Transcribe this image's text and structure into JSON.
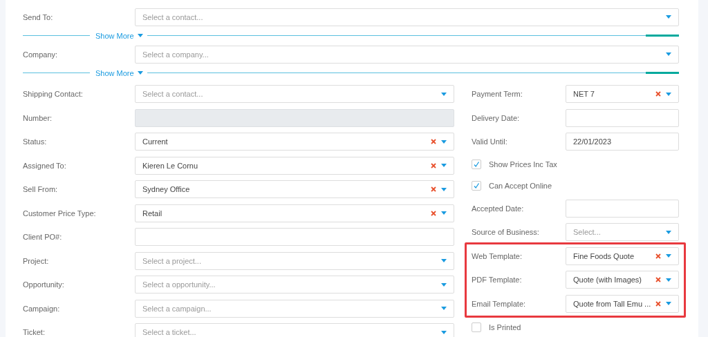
{
  "top_sections": [
    {
      "label": "Send To:",
      "field": {
        "kind": "select",
        "placeholder": "Select a contact..."
      },
      "show_more": "Show More"
    },
    {
      "label": "Company:",
      "field": {
        "kind": "select",
        "placeholder": "Select a company..."
      },
      "show_more": "Show More"
    }
  ],
  "left_column": [
    {
      "label": "Shipping Contact:",
      "field": {
        "kind": "select",
        "placeholder": "Select a contact..."
      }
    },
    {
      "label": "Number:",
      "field": {
        "kind": "text",
        "disabled": true
      }
    },
    {
      "label": "Status:",
      "field": {
        "kind": "select",
        "value": "Current",
        "clearable": true
      }
    },
    {
      "label": "Assigned To:",
      "field": {
        "kind": "select",
        "value": "Kieren Le Cornu",
        "clearable": true
      }
    },
    {
      "label": "Sell From:",
      "field": {
        "kind": "select",
        "value": "Sydney Office",
        "clearable": true
      }
    },
    {
      "label": "Customer Price Type:",
      "field": {
        "kind": "select",
        "value": "Retail",
        "clearable": true
      }
    },
    {
      "label": "Client PO#:",
      "field": {
        "kind": "text",
        "disabled": false
      }
    },
    {
      "label": "Project:",
      "field": {
        "kind": "select",
        "placeholder": "Select a project..."
      }
    },
    {
      "label": "Opportunity:",
      "field": {
        "kind": "select",
        "placeholder": "Select a opportunity..."
      }
    },
    {
      "label": "Campaign:",
      "field": {
        "kind": "select",
        "placeholder": "Select a campaign..."
      }
    },
    {
      "label": "Ticket:",
      "field": {
        "kind": "select",
        "placeholder": "Select a ticket..."
      }
    }
  ],
  "right_column": [
    {
      "kind": "field",
      "label": "Payment Term:",
      "field": {
        "kind": "select",
        "value": "NET 7",
        "clearable": true
      }
    },
    {
      "kind": "field",
      "label": "Delivery Date:",
      "field": {
        "kind": "text",
        "disabled": false
      }
    },
    {
      "kind": "field",
      "label": "Valid Until:",
      "field": {
        "kind": "text",
        "value": "22/01/2023",
        "disabled": false
      }
    },
    {
      "kind": "checkbox",
      "label": "Show Prices Inc Tax",
      "checked": true
    },
    {
      "kind": "checkbox",
      "label": "Can Accept Online",
      "checked": true
    },
    {
      "kind": "field",
      "label": "Accepted Date:",
      "field": {
        "kind": "text",
        "disabled": false
      }
    },
    {
      "kind": "field",
      "label": "Source of Business:",
      "field": {
        "kind": "select",
        "placeholder": "Select..."
      }
    },
    {
      "kind": "highlight_group",
      "rows": [
        {
          "kind": "field",
          "label": "Web Template:",
          "field": {
            "kind": "select",
            "value": "Fine Foods Quote",
            "clearable": true
          }
        },
        {
          "kind": "field",
          "label": "PDF Template:",
          "field": {
            "kind": "select",
            "value": "Quote (with Images)",
            "clearable": true
          }
        },
        {
          "kind": "field",
          "label": "Email Template:",
          "field": {
            "kind": "select",
            "value": "Quote from Tall Emu ...",
            "clearable": true
          }
        }
      ]
    },
    {
      "kind": "checkbox",
      "label": "Is Printed",
      "checked": false
    }
  ]
}
